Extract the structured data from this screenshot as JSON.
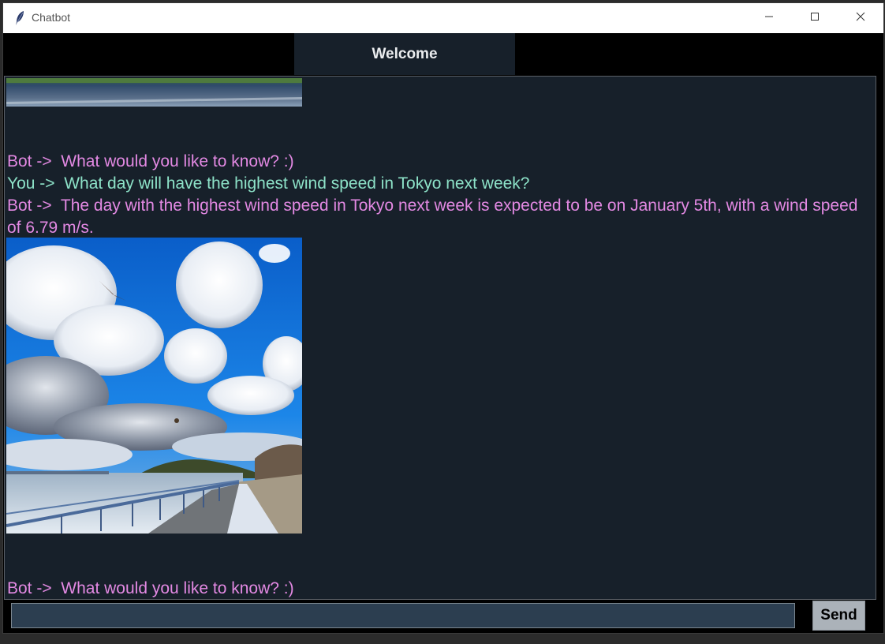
{
  "window": {
    "title": "Chatbot",
    "icon": "feather-icon",
    "controls": [
      "minimize-icon",
      "maximize-icon",
      "close-icon"
    ]
  },
  "header": {
    "title": "Welcome"
  },
  "chat": {
    "messages": [
      {
        "sender": "bot",
        "text": "Bot ->  What would you like to know? :)"
      },
      {
        "sender": "you",
        "text": "You ->  What day will have the highest wind speed in Tokyo next week?"
      },
      {
        "sender": "bot",
        "text": "Bot ->  The day with the highest wind speed in Tokyo next week is expected to be on January 5th, with a wind speed of 6.79 m/s."
      },
      {
        "sender": "bot",
        "text": "Bot ->  What would you like to know? :)"
      }
    ]
  },
  "input": {
    "value": "",
    "send_label": "Send"
  },
  "colors": {
    "background": "#17202a",
    "bot_text": "#e389e3",
    "user_text": "#8de2c8",
    "input_bg": "#2c3e50",
    "button_bg": "#abb2b9"
  }
}
